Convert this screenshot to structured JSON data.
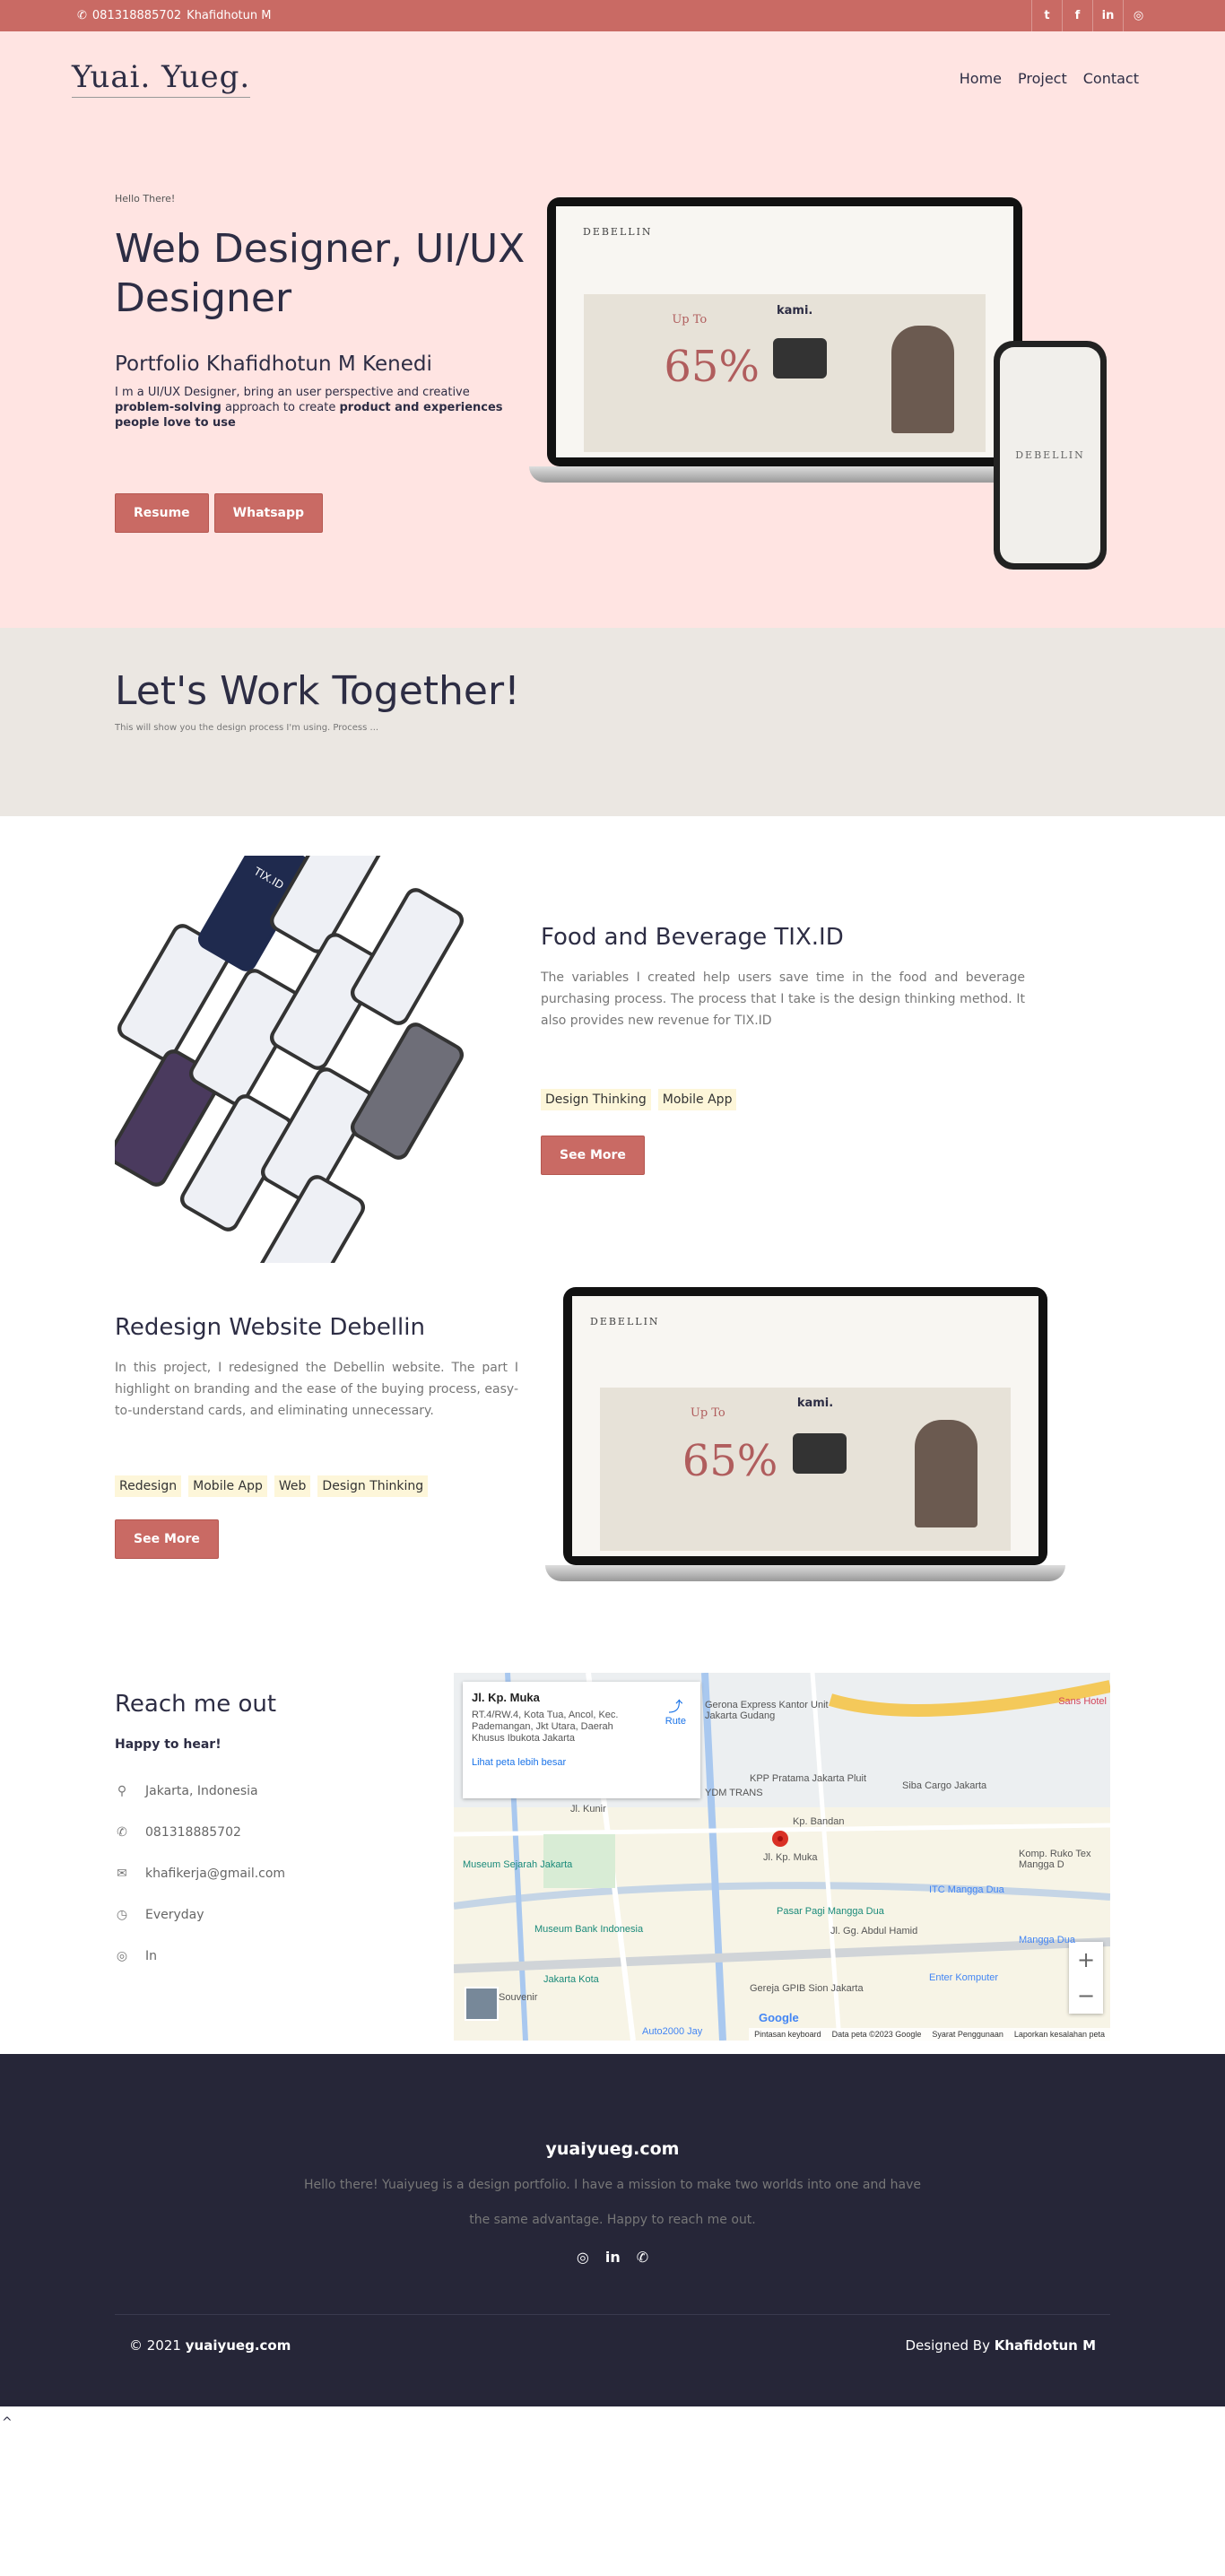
{
  "topbar": {
    "phone": "081318885702",
    "name": "Khafidhotun M",
    "social": [
      "twitter-icon",
      "facebook-icon",
      "linkedin-icon",
      "instagram-icon"
    ]
  },
  "brand": {
    "logo": "Yuai. Yueg."
  },
  "nav": {
    "items": [
      "Home",
      "Project",
      "Contact"
    ]
  },
  "hero": {
    "greeting": "Hello There!",
    "title": "Web Designer, UI/UX Designer",
    "subtitle": "Portfolio Khafidhotun M Kenedi",
    "intro": "I m a UI/UX Designer, bring an user perspective and creative",
    "intro_bold1": "problem-solving",
    "intro_mid": "approach to create",
    "intro_bold2": "product and experiences people love to use",
    "btn_resume": "Resume",
    "btn_whatsapp": "Whatsapp",
    "mock_brand": "DEBELLIN",
    "mock_sale": "65%",
    "mock_upto": "Up To",
    "mock_kami": "kami."
  },
  "together": {
    "title": "Let's Work Together!",
    "subtitle": "This will show you the design process I'm using. Process ..."
  },
  "projects": [
    {
      "title": "Food and Beverage TIX.ID",
      "desc": "The variables I created help users save time in the food and beverage purchasing process. The process that I take is the design thinking method. It also provides new revenue for TIX.ID",
      "tags": [
        "Design Thinking",
        "Mobile App"
      ],
      "button": "See More",
      "art_label": "TIX.ID"
    },
    {
      "title": "Redesign Website Debellin",
      "desc": "In this project, I redesigned the Debellin website. The part I highlight on branding and the ease of the buying process, easy-to-understand cards, and eliminating unnecessary.",
      "tags": [
        "Redesign",
        "Mobile App",
        "Web",
        "Design Thinking"
      ],
      "button": "See More"
    }
  ],
  "reach": {
    "title": "Reach me out",
    "tagline": "Happy to hear!",
    "items": [
      {
        "icon": "map-marker-icon",
        "text": "Jakarta, Indonesia"
      },
      {
        "icon": "phone-icon",
        "text": "081318885702"
      },
      {
        "icon": "envelope-icon",
        "text": "khafikerja@gmail.com"
      },
      {
        "icon": "clock-icon",
        "text": "Everyday"
      },
      {
        "icon": "instagram-icon",
        "text": "In"
      }
    ]
  },
  "map": {
    "place": "Jl. Kp. Muka",
    "address": "RT.4/RW.4, Kota Tua, Ancol, Kec. Pademangan, Jkt Utara, Daerah Khusus Ibukota Jakarta",
    "larger": "Lihat peta lebih besar",
    "route": "Rute",
    "labels": [
      "Sans Hotel",
      "Gerona Express Kantor Unit Jakarta Gudang",
      "KPP Pratama Jakarta Pluit",
      "Siba Cargo Jakarta",
      "YDM TRANS",
      "Kp. Bandan",
      "Jl. Kp. Muka",
      "Museum Sejarah Jakarta",
      "Museum Bank Indonesia",
      "Pasar Pagi Mangga Dua",
      "ITC Mangga Dua",
      "Komp. Ruko Tex Mangga D",
      "Jl. Gg. Abdul Hamid",
      "Mangga Dua",
      "Jakarta Kota",
      "Gereja GPIB Sion Jakarta",
      "Enter Komputer",
      "Souvenir",
      "Auto2000 Jay",
      "Jl. Kunir"
    ],
    "footer": [
      "Pintasan keyboard",
      "Data peta ©2023 Google",
      "Syarat Penggunaan",
      "Laporkan kesalahan peta"
    ],
    "google": "Google",
    "zoom_in": "+",
    "zoom_out": "−"
  },
  "footer": {
    "site": "yuaiyueg.com",
    "desc": "Hello there! Yuaiyueg is a design portfolio. I have a mission to make two worlds into one and have the same advantage. Happy to reach me out.",
    "copyright_prefix": "© 2021",
    "copyright_site": "yuaiyueg.com",
    "designed_prefix": "Designed By",
    "designed_name": "Khafidotun M"
  },
  "colors": {
    "accent": "#c96a64",
    "hero_bg": "#ffe4e2",
    "footer_bg": "#262638",
    "tag_bg": "#fdf6d9"
  }
}
